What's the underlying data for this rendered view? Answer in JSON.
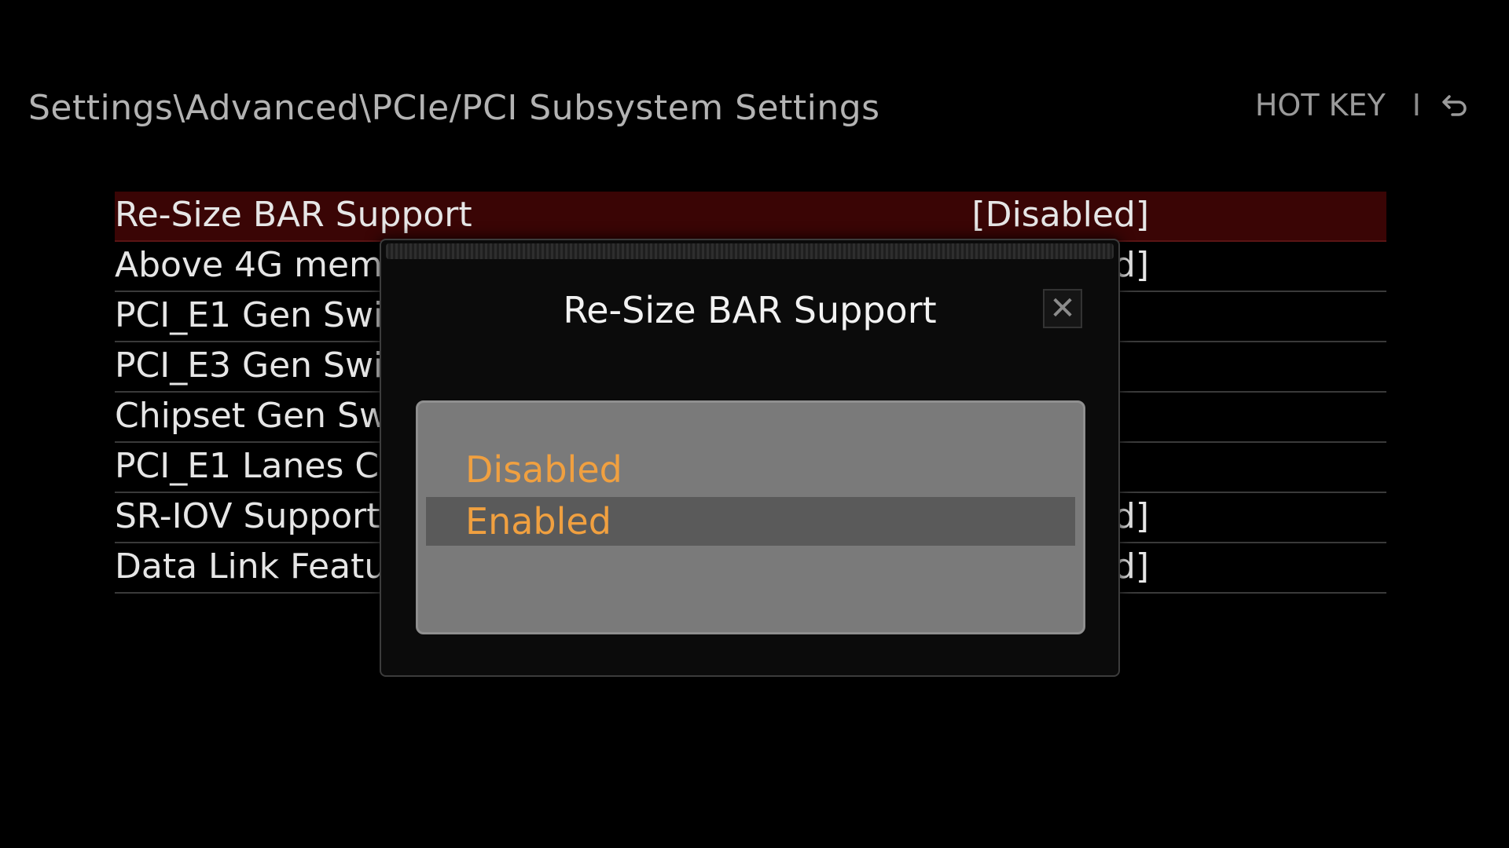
{
  "header": {
    "breadcrumb": "Settings\\Advanced\\PCIe/PCI Subsystem Settings",
    "hotkey_label": "HOT KEY",
    "separator": "I",
    "back_icon": "return-arrow-icon"
  },
  "settings": [
    {
      "label": "Re-Size BAR Support",
      "value": "[Disabled]",
      "selected": true
    },
    {
      "label": "Above 4G memo",
      "value": "d]"
    },
    {
      "label": "PCI_E1 Gen Swi",
      "value": ""
    },
    {
      "label": "PCI_E3 Gen Swi",
      "value": ""
    },
    {
      "label": "Chipset Gen Sw",
      "value": ""
    },
    {
      "label": "PCI_E1 Lanes C",
      "value": ""
    },
    {
      "label": "SR-IOV Support",
      "value": "d]"
    },
    {
      "label": "Data Link Featu",
      "value": "d]"
    }
  ],
  "dialog": {
    "title": "Re-Size BAR Support",
    "close_label": "✕",
    "options": [
      {
        "label": "Disabled",
        "highlighted": false
      },
      {
        "label": "Enabled",
        "highlighted": true
      }
    ]
  },
  "colors": {
    "background": "#000000",
    "selected_row": "#3a0505",
    "option_text": "#f0a040",
    "option_panel": "#7a7a7a",
    "option_highlight": "#5a5a5a"
  }
}
